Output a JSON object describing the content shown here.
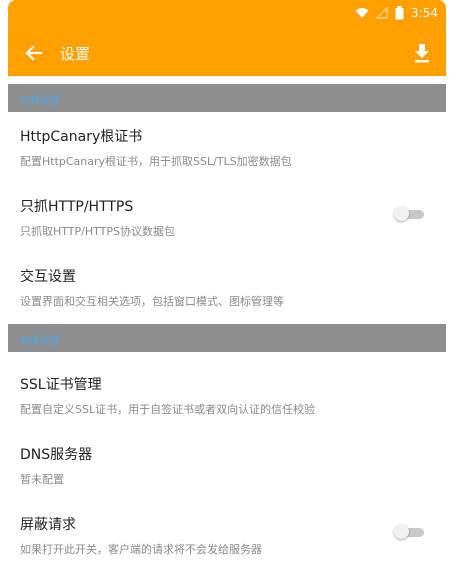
{
  "status_bar": {
    "time": "3:54",
    "icons": [
      "wifi-icon",
      "signal-icon",
      "battery-icon"
    ]
  },
  "app_bar": {
    "title": "设置",
    "back_icon": "arrow-back-icon",
    "action_icon": "download-icon"
  },
  "sections": [
    {
      "header": "常规设置",
      "items": [
        {
          "title": "HttpCanary根证书",
          "subtitle": "配置HttpCanary根证书，用于抓取SSL/TLS加密数据包",
          "has_toggle": false
        },
        {
          "title": "只抓HTTP/HTTPS",
          "subtitle": "只抓取HTTP/HTTPS协议数据包",
          "has_toggle": true,
          "toggle_on": false
        },
        {
          "title": "交互设置",
          "subtitle": "设置界面和交互相关选项，包括窗口模式、图标管理等",
          "has_toggle": false
        }
      ]
    },
    {
      "header": "高级设置",
      "items": [
        {
          "title": "SSL证书管理",
          "subtitle": "配置自定义SSL证书，用于自签证书或者双向认证的信任校验",
          "has_toggle": false
        },
        {
          "title": "DNS服务器",
          "subtitle": "暂未配置",
          "has_toggle": false
        },
        {
          "title": "屏蔽请求",
          "subtitle": "如果打开此开关，客户端的请求将不会发给服务器",
          "has_toggle": true,
          "toggle_on": false
        }
      ]
    }
  ],
  "colors": {
    "accent": "#FFA000",
    "section_bg": "#8E8E8E",
    "section_text": "#4FA8E8"
  }
}
